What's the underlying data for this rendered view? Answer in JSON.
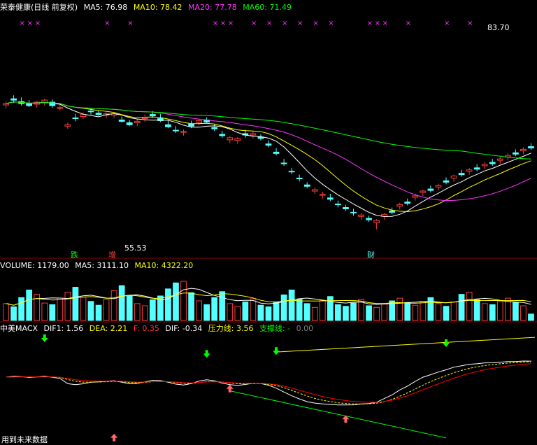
{
  "colors": {
    "up": "#ff3b3b",
    "down": "#54ffff",
    "ma5": "#ffffff",
    "ma10": "#ffff00",
    "ma20": "#ff33ff",
    "ma60": "#00ff00",
    "grid": "#8b0000",
    "bg": "#000000"
  },
  "price_header": {
    "title": "荣泰健康(日线 前复权)",
    "ma5": "MA5: 76.98",
    "ma10": "MA10: 78.42",
    "ma20": "MA20: 77.78",
    "ma60": "MA60: 71.49"
  },
  "volume_header": {
    "volume": "VOLUME: 1179.00",
    "ma5": "MA5: 3111.10",
    "ma10": "MA10: 4322.20"
  },
  "macd_header": {
    "name": "中美MACX",
    "dif1": "DIF1: 1.56",
    "dea": "DEA: 2.21",
    "f": "F: 0.35",
    "dif": "DIF: -0.34",
    "resist": "压力线: 3.56",
    "support": "支撑线: -",
    "support_val": "0.00"
  },
  "footer": "用到未来数据",
  "annotations": {
    "high_label": "83.70",
    "low_label": "55.53",
    "tag_die": "跌",
    "tag_zeng": "增",
    "tag_cai": "财"
  },
  "chart_data": {
    "type": "candlestick",
    "price_range": [
      52,
      87
    ],
    "volume_range": [
      0,
      9000
    ],
    "macd_range": [
      -6.5,
      4.5
    ],
    "high_mark": 83.7,
    "low_mark": 55.53,
    "ohlc": [
      [
        73.7,
        74.2,
        73.2,
        73.9
      ],
      [
        74.6,
        75.1,
        74.0,
        74.4
      ],
      [
        74.2,
        74.8,
        73.6,
        73.9
      ],
      [
        73.9,
        74.4,
        73.4,
        73.6
      ],
      [
        73.8,
        74.3,
        73.3,
        74.1
      ],
      [
        74.1,
        74.6,
        73.6,
        74.4
      ],
      [
        74.1,
        74.5,
        73.3,
        73.6
      ],
      [
        73.3,
        73.8,
        72.9,
        73.3
      ],
      [
        70.6,
        71.1,
        70.2,
        70.8
      ],
      [
        71.8,
        72.4,
        71.3,
        71.7
      ],
      [
        72.0,
        72.6,
        71.6,
        72.3
      ],
      [
        72.8,
        73.3,
        72.3,
        72.7
      ],
      [
        72.5,
        72.9,
        72.1,
        72.3
      ],
      [
        72.2,
        72.6,
        71.8,
        72.4
      ],
      [
        72.2,
        72.6,
        71.8,
        72.4
      ],
      [
        71.5,
        72.0,
        71.1,
        71.3
      ],
      [
        71.1,
        71.5,
        70.6,
        70.8
      ],
      [
        71.1,
        71.6,
        70.6,
        71.3
      ],
      [
        71.7,
        72.3,
        71.2,
        71.9
      ],
      [
        72.3,
        72.8,
        71.8,
        72.1
      ],
      [
        71.7,
        72.4,
        71.2,
        71.4
      ],
      [
        70.8,
        71.4,
        70.3,
        70.5
      ],
      [
        70.0,
        70.6,
        69.6,
        69.9
      ],
      [
        69.7,
        70.1,
        69.2,
        69.8
      ],
      [
        70.9,
        71.4,
        70.3,
        70.6
      ],
      [
        71.1,
        71.7,
        70.7,
        71.4
      ],
      [
        71.5,
        71.9,
        71.0,
        71.2
      ],
      [
        70.4,
        70.9,
        69.9,
        70.2
      ],
      [
        69.4,
        69.9,
        68.9,
        69.2
      ],
      [
        68.6,
        69.1,
        68.1,
        68.9
      ],
      [
        68.5,
        69.0,
        68.0,
        68.8
      ],
      [
        69.5,
        70.1,
        68.9,
        69.3
      ],
      [
        69.3,
        69.8,
        68.8,
        69.5
      ],
      [
        69.0,
        69.4,
        68.5,
        68.8
      ],
      [
        68.0,
        68.5,
        67.5,
        67.8
      ],
      [
        66.8,
        67.4,
        66.3,
        66.6
      ],
      [
        65.2,
        65.8,
        64.8,
        65.1
      ],
      [
        64.0,
        64.5,
        63.6,
        63.9
      ],
      [
        63.0,
        63.5,
        62.5,
        62.9
      ],
      [
        62.0,
        62.4,
        61.5,
        61.8
      ],
      [
        61.1,
        61.6,
        60.7,
        61.3
      ],
      [
        60.5,
        61.0,
        60.0,
        60.6
      ],
      [
        60.1,
        60.7,
        59.6,
        59.9
      ],
      [
        59.2,
        59.7,
        58.7,
        59.1
      ],
      [
        58.7,
        59.1,
        58.2,
        58.5
      ],
      [
        58.0,
        58.5,
        57.5,
        57.9
      ],
      [
        57.4,
        57.9,
        56.9,
        57.6
      ],
      [
        57.1,
        57.5,
        56.6,
        56.9
      ],
      [
        56.5,
        57.0,
        55.5,
        56.8
      ],
      [
        57.4,
        57.9,
        56.9,
        57.7
      ],
      [
        58.2,
        58.7,
        57.7,
        58.0
      ],
      [
        58.9,
        59.4,
        58.4,
        59.1
      ],
      [
        59.5,
        60.0,
        59.0,
        59.3
      ],
      [
        60.2,
        60.7,
        59.7,
        60.4
      ],
      [
        60.9,
        61.3,
        60.4,
        61.1
      ],
      [
        61.4,
        61.9,
        60.9,
        61.2
      ],
      [
        61.7,
        62.2,
        61.2,
        61.9
      ],
      [
        62.6,
        63.1,
        62.1,
        62.4
      ],
      [
        63.0,
        63.5,
        62.5,
        63.3
      ],
      [
        63.7,
        64.2,
        63.2,
        63.5
      ],
      [
        64.0,
        64.5,
        63.5,
        64.2
      ],
      [
        64.5,
        65.0,
        64.0,
        64.3
      ],
      [
        64.8,
        65.3,
        64.3,
        65.0
      ],
      [
        65.3,
        65.8,
        64.8,
        65.1
      ],
      [
        65.6,
        66.1,
        65.1,
        65.8
      ],
      [
        66.1,
        66.6,
        65.6,
        66.3
      ],
      [
        66.7,
        67.2,
        66.2,
        66.5
      ],
      [
        67.0,
        67.5,
        66.5,
        67.2
      ],
      [
        67.6,
        68.1,
        67.1,
        67.4
      ]
    ],
    "volume": [
      3100,
      2500,
      4200,
      5600,
      4800,
      3200,
      2900,
      4100,
      5200,
      6100,
      4300,
      3500,
      2800,
      3900,
      5500,
      6400,
      4600,
      3100,
      2700,
      3800,
      4500,
      5800,
      6900,
      7200,
      5100,
      3600,
      2900,
      4200,
      5300,
      3100,
      2600,
      3400,
      4000,
      2800,
      2500,
      3300,
      4700,
      5600,
      3900,
      3100,
      2400,
      3700,
      4400,
      2900,
      2600,
      3200,
      3900,
      2700,
      2400,
      3000,
      3600,
      4100,
      3300,
      2800,
      3500,
      4200,
      3100,
      2600,
      3400,
      4800,
      5200,
      3800,
      3100,
      2900,
      3500,
      4100,
      3300,
      2700,
      1179
    ],
    "macd_lines": [
      {
        "name": "DIF1",
        "color": "#ffffff"
      },
      {
        "name": "DEA",
        "color": "#ffff00"
      },
      {
        "name": "F",
        "color": "#ff0000"
      }
    ],
    "pressure_line": {
      "name": "压力线",
      "value": 3.56,
      "color": "#ffff00"
    },
    "support_line": {
      "name": "支撑线",
      "color": "#00ff00"
    }
  }
}
